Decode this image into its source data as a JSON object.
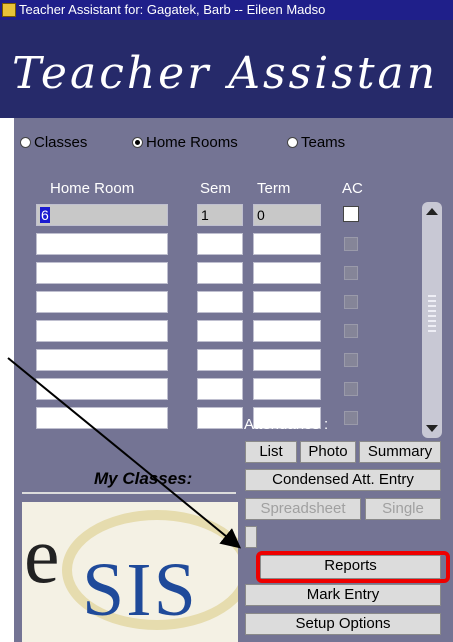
{
  "window": {
    "title": "Teacher Assistant for: Gagatek, Barb -- Eileen Madso"
  },
  "banner": {
    "title": "Teacher Assistan"
  },
  "view_options": [
    {
      "label": "Classes",
      "selected": false
    },
    {
      "label": "Home Rooms",
      "selected": true
    },
    {
      "label": "Teams",
      "selected": false
    }
  ],
  "grid": {
    "headers": {
      "home_room": "Home Room",
      "sem": "Sem",
      "term": "Term",
      "ac": "AC"
    },
    "rows": [
      {
        "home_room": "6",
        "sem": "1",
        "term": "0",
        "ac": false
      },
      {
        "home_room": "",
        "sem": "",
        "term": "",
        "ac": false
      },
      {
        "home_room": "",
        "sem": "",
        "term": "",
        "ac": false
      },
      {
        "home_room": "",
        "sem": "",
        "term": "",
        "ac": false
      },
      {
        "home_room": "",
        "sem": "",
        "term": "",
        "ac": false
      },
      {
        "home_room": "",
        "sem": "",
        "term": "",
        "ac": false
      },
      {
        "home_room": "",
        "sem": "",
        "term": "",
        "ac": false
      },
      {
        "home_room": "",
        "sem": "",
        "term": "",
        "ac": false
      }
    ]
  },
  "attendance": {
    "label": "Attendance :",
    "list": "List",
    "photo": "Photo",
    "summary": "Summary",
    "condensed": "Condensed Att. Entry",
    "spreadsheet": "Spreadsheet",
    "single": "Single"
  },
  "my_classes_label": "My Classes:",
  "actions": {
    "reports": "Reports",
    "mark_entry": "Mark Entry",
    "setup_options": "Setup Options"
  },
  "logo": {
    "e": "e",
    "sis": "SIS"
  },
  "colors": {
    "highlight": "#ee0000",
    "panel": "#747494",
    "banner": "#262a6a"
  }
}
